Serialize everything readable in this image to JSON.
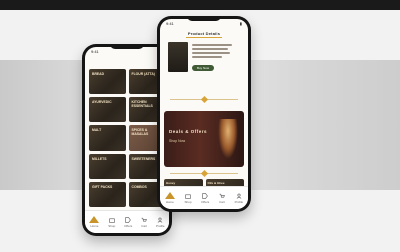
{
  "back_phone": {
    "status_time": "9:41",
    "tiles": [
      {
        "label": "Bread",
        "style": "dark"
      },
      {
        "label": "Flour (Atta)",
        "style": "dark"
      },
      {
        "label": "Ayurvedic",
        "style": "dark"
      },
      {
        "label": "Kitchen Essentials",
        "style": "dark"
      },
      {
        "label": "Malt",
        "style": "dark"
      },
      {
        "label": "Spices & Masalas",
        "style": "light"
      },
      {
        "label": "Millets",
        "style": "dark"
      },
      {
        "label": "Sweeteners",
        "style": "dark"
      },
      {
        "label": "Gift Packs",
        "style": "dark"
      },
      {
        "label": "Combos",
        "style": "dark"
      }
    ]
  },
  "front_phone": {
    "status_time": "9:41",
    "page_title": "Product Details",
    "buy_button": "Buy Now",
    "banner": {
      "title": "Deals & Offers",
      "subtitle": "Shop Now"
    },
    "mini_tiles": [
      "Honey",
      "Oils & Ghee"
    ]
  },
  "tabbar": {
    "tabs": [
      {
        "label": "Home",
        "icon": "home-icon"
      },
      {
        "label": "Shop",
        "icon": "bag-icon"
      },
      {
        "label": "Offers",
        "icon": "tag-icon"
      },
      {
        "label": "Cart",
        "icon": "cart-icon"
      },
      {
        "label": "Profile",
        "icon": "user-icon"
      }
    ]
  },
  "colors": {
    "accent": "#d8a437",
    "tile_dark": "#2a241c",
    "button_green": "#3f5a34"
  }
}
